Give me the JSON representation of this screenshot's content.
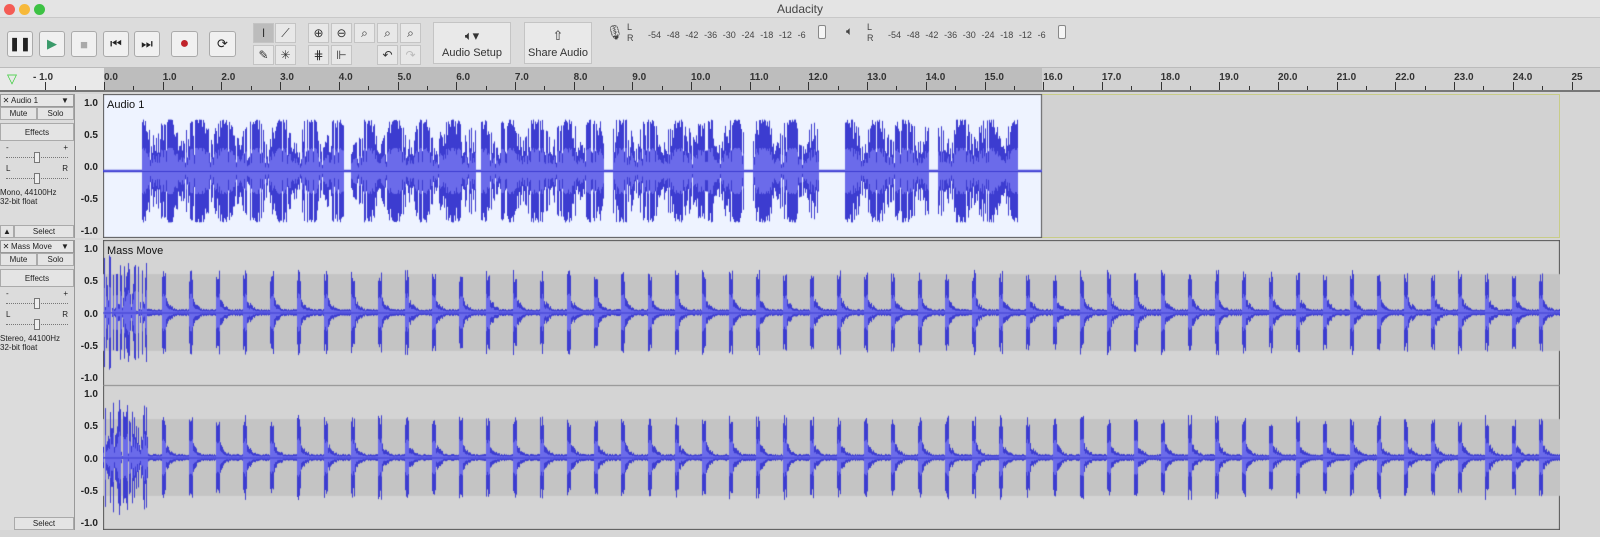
{
  "window": {
    "title": "Audacity"
  },
  "toolbar": {
    "audio_setup": "Audio Setup",
    "share_audio": "Share Audio",
    "record_meter": {
      "channels": [
        "L",
        "R"
      ],
      "ticks": [
        "-54",
        "-48",
        "-42",
        "-36",
        "-30",
        "-24",
        "-18",
        "-12",
        "-6"
      ]
    },
    "play_meter": {
      "channels": [
        "L",
        "R"
      ],
      "ticks": [
        "-54",
        "-48",
        "-42",
        "-36",
        "-30",
        "-24",
        "-18",
        "-12",
        "-6"
      ]
    }
  },
  "ruler": {
    "labels": [
      "- 1.0",
      "0.0",
      "1.0",
      "2.0",
      "3.0",
      "4.0",
      "5.0",
      "6.0",
      "7.0",
      "8.0",
      "9.0",
      "10.0",
      "11.0",
      "12.0",
      "13.0",
      "14.0",
      "15.0",
      "16.0",
      "17.0",
      "18.0",
      "19.0",
      "20.0",
      "21.0",
      "22.0",
      "23.0",
      "24.0",
      "25"
    ]
  },
  "tracks": [
    {
      "name": "Audio 1",
      "clip": "Audio 1",
      "mute": "Mute",
      "solo": "Solo",
      "effects": "Effects",
      "gain_minus": "-",
      "gain_plus": "+",
      "pan_l": "L",
      "pan_r": "R",
      "info1": "Mono, 44100Hz",
      "info2": "32-bit float",
      "select": "Select",
      "scale": [
        "1.0",
        "0.5",
        "0.0",
        "-0.5",
        "-1.0"
      ]
    },
    {
      "name": "Mass Move",
      "clip": "Mass Move",
      "mute": "Mute",
      "solo": "Solo",
      "effects": "Effects",
      "gain_minus": "-",
      "gain_plus": "+",
      "pan_l": "L",
      "pan_r": "R",
      "info1": "Stereo, 44100Hz",
      "info2": "32-bit float",
      "select": "Select",
      "scale": [
        "1.0",
        "0.5",
        "0.0",
        "-0.5",
        "-1.0"
      ]
    }
  ],
  "colors": {
    "wave": "#3c3cd0",
    "wave_light": "#6b6bea",
    "clip_bg_selected": "#eef3ff",
    "clip_bg": "#d4d4d4"
  }
}
